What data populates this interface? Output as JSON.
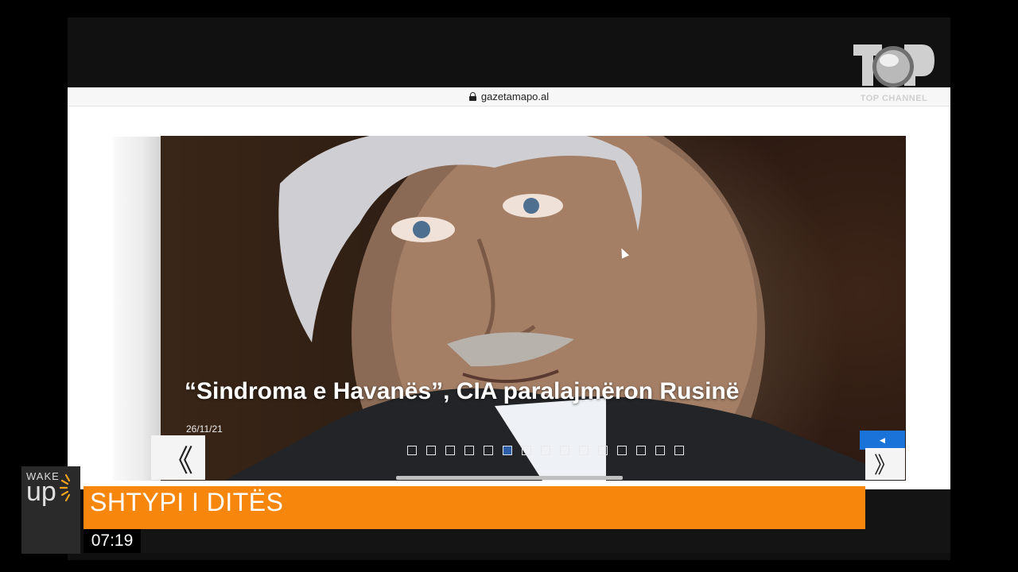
{
  "browser": {
    "url": "gazetamapo.al"
  },
  "slider": {
    "title": "“Sindroma e Havanës”, CIA paralajmëron Rusinë",
    "date": "26/11/21",
    "prev_label": "《",
    "next_label": "》",
    "play_label": "◀",
    "dots": {
      "total": 15,
      "active_index": 5
    }
  },
  "broadcast": {
    "channel_logo_text": "TOP CHANNEL",
    "show_logo_top": "WAKE",
    "show_logo_bottom": "up",
    "segment_title": "SHTYPI I DITËS",
    "time": "07:19"
  },
  "colors": {
    "segment_bar": "#f7860c",
    "active_dot": "#2f5ea8",
    "play_button": "#1a73d9"
  }
}
